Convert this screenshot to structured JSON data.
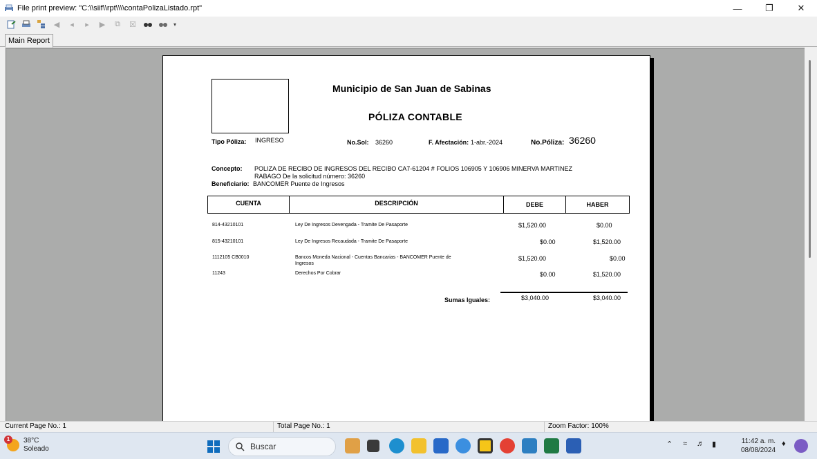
{
  "window": {
    "title": "File print preview: \"C:\\\\siif\\\\rpt\\\\\\\\contaPolizaListado.rpt\""
  },
  "tab": {
    "label": "Main Report"
  },
  "report": {
    "municipio": "Municipio de San Juan de Sabinas",
    "titulo": "PÓLIZA CONTABLE",
    "tipo_poliza_label": "Tipo Póliza:",
    "tipo_poliza": "INGRESO",
    "no_sol_label": "No.Sol:",
    "no_sol": "36260",
    "f_afectacion_label": "F. Afectación:",
    "f_afectacion": "1-abr.-2024",
    "no_poliza_label": "No.Póliza:",
    "no_poliza": "36260",
    "concepto_label": "Concepto:",
    "concepto_line1": "POLIZA DE RECIBO DE INGRESOS DEL RECIBO CA7-61204 # FOLIOS 106905 Y 106906 MINERVA MARTINEZ",
    "concepto_line2": "RABAGO De la solicitud número: 36260",
    "beneficiario_label": "Beneficiario:",
    "beneficiario": "BANCOMER Puente de Ingresos",
    "headers": {
      "cuenta": "CUENTA",
      "descripcion": "DESCRIPCIÓN",
      "debe": "DEBE",
      "haber": "HABER"
    },
    "rows": [
      {
        "cuenta": "814-43210101",
        "descripcion": "Ley De Ingresos Devengada - Tramite De Pasaporte",
        "descripcion2": "",
        "debe": "$1,520.00",
        "haber": "$0.00"
      },
      {
        "cuenta": "815-43210101",
        "descripcion": "Ley De Ingresos Recaudada - Tramite De Pasaporte",
        "descripcion2": "",
        "debe": "$0.00",
        "haber": "$1,520.00"
      },
      {
        "cuenta": "1112105 CB0010",
        "descripcion": "Bancos Moneda Nacional - Cuentas Bancarias - BANCOMER Puente de",
        "descripcion2": "Ingresos",
        "debe": "$1,520.00",
        "haber": "$0.00"
      },
      {
        "cuenta": "11243",
        "descripcion": "Derechos Por Cobrar",
        "descripcion2": "",
        "debe": "$0.00",
        "haber": "$1,520.00"
      }
    ],
    "sumas_label": "Sumas Iguales:",
    "sumas_debe": "$3,040.00",
    "sumas_haber": "$3,040.00"
  },
  "status": {
    "current_page": "Current Page No.: 1",
    "total_page": "Total Page No.: 1",
    "zoom": "Zoom Factor: 100%"
  },
  "taskbar": {
    "temp": "38°C",
    "weather": "Soleado",
    "weather_badge": "1",
    "search_placeholder": "Buscar",
    "time": "11:42 a. m.",
    "date": "08/08/2024"
  }
}
